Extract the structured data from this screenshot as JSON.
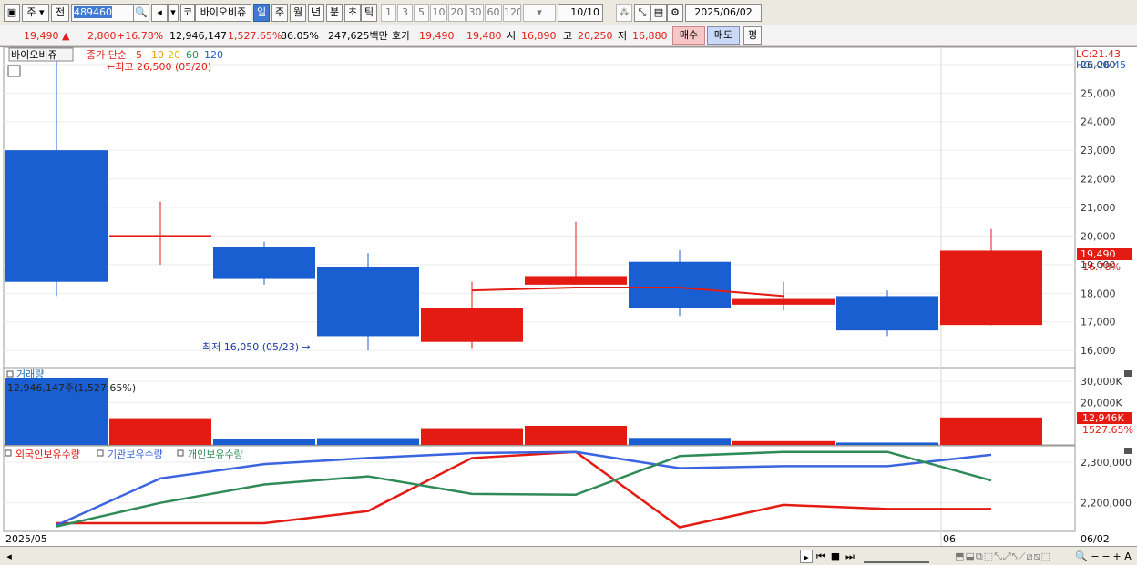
{
  "toolbar": {
    "period_type": "주",
    "prev_label": "전",
    "code": "489460",
    "board_label": "코",
    "stock_name": "바이오비쥬",
    "periods": [
      "일",
      "주",
      "월",
      "년",
      "분",
      "초",
      "틱"
    ],
    "active_period": "일",
    "intervals": [
      "1",
      "3",
      "5",
      "10",
      "20",
      "30",
      "60",
      "120"
    ],
    "count": "10/10",
    "date": "2025/06/02"
  },
  "info": {
    "price": "19,490",
    "change": "2,800",
    "change_pct": "+16.78%",
    "volume": "12,946,147",
    "volume_pct": "1,527.65%",
    "pct3": "86.05%",
    "amount": "247,625백만",
    "quote_label": "호가",
    "ask": "19,490",
    "bid": "19,480",
    "open_label": "시",
    "open": "16,890",
    "high_label": "고",
    "high": "20,250",
    "low_label": "저",
    "low": "16,880",
    "buy_label": "매수",
    "sell_label": "매도",
    "avg_label": "평"
  },
  "price_panel": {
    "stock_label": "바이오비쥬",
    "ma_label": "종가 단순",
    "ma_periods": [
      "5",
      "10",
      "20",
      "60",
      "120"
    ],
    "high_note": "최고 26,500 (05/20)",
    "low_note": "최저 16,050 (05/23)",
    "lc": "LC:21.43",
    "hc": "HC:-26.45",
    "price_tag": "19,490",
    "pct_tag": "16.78%"
  },
  "volume_panel": {
    "title": "거래량",
    "value_label": "12,946,147주(1,527.65%)",
    "vol_tag": "12,946K",
    "pct_tag": "1527.65%"
  },
  "holdings_panel": {
    "legend": [
      "외국인보유수량",
      "기관보유수량",
      "개인보유수량"
    ]
  },
  "x_axis": {
    "left_label": "2025/05",
    "month_label": "06",
    "right_label": "06/02"
  },
  "colors": {
    "up": "#e31b12",
    "down": "#1a5fd1",
    "ma5": "#e31b12",
    "foreign": "#e31b12",
    "institution": "#3a64e0",
    "individual": "#2e8b57"
  },
  "chart_data": [
    {
      "type": "candlestick",
      "title": "",
      "yticks": [
        16000,
        17000,
        18000,
        19000,
        20000,
        21000,
        22000,
        23000,
        24000,
        25000,
        26000
      ],
      "ylim": [
        15400,
        26600
      ],
      "candles": [
        {
          "open": 23000,
          "high": 26500,
          "low": 17900,
          "close": 18400
        },
        {
          "open": 20000,
          "high": 21200,
          "low": 19000,
          "close": 20000
        },
        {
          "open": 19600,
          "high": 19800,
          "low": 18300,
          "close": 18500
        },
        {
          "open": 18900,
          "high": 19400,
          "low": 16000,
          "close": 16500
        },
        {
          "open": 16300,
          "high": 18400,
          "low": 16050,
          "close": 17500
        },
        {
          "open": 18300,
          "high": 20500,
          "low": 18300,
          "close": 18600
        },
        {
          "open": 19100,
          "high": 19500,
          "low": 17200,
          "close": 17500
        },
        {
          "open": 17600,
          "high": 18400,
          "low": 17400,
          "close": 17800
        },
        {
          "open": 17900,
          "high": 18100,
          "low": 16500,
          "close": 16700
        },
        {
          "open": 16890,
          "high": 20250,
          "low": 16880,
          "close": 19490
        }
      ],
      "ma5": [
        null,
        null,
        null,
        null,
        18100,
        18200,
        18200,
        17900,
        null,
        null
      ]
    },
    {
      "type": "bar",
      "title": "거래량",
      "yticks": [
        20000,
        30000
      ],
      "ylabel_unit": "K",
      "values": [
        31500,
        12600,
        2600,
        3200,
        7900,
        9000,
        3300,
        1800,
        1100,
        12946
      ]
    },
    {
      "type": "line",
      "yticks": [
        2200000,
        2300000
      ],
      "ylim": [
        2130000,
        2340000
      ],
      "series": [
        {
          "name": "외국인보유수량",
          "values": [
            2150000,
            2150000,
            2150000,
            2180000,
            2310000,
            2325000,
            2140000,
            2195000,
            2185000,
            2185000
          ]
        },
        {
          "name": "기관보유수량",
          "values": [
            2145000,
            2260000,
            2295000,
            2310000,
            2322000,
            2325000,
            2285000,
            2290000,
            2290000,
            2318000
          ]
        },
        {
          "name": "개인보유수량",
          "values": [
            2142000,
            2200000,
            2245000,
            2265000,
            2222000,
            2220000,
            2315000,
            2325000,
            2325000,
            2255000
          ]
        }
      ]
    }
  ]
}
